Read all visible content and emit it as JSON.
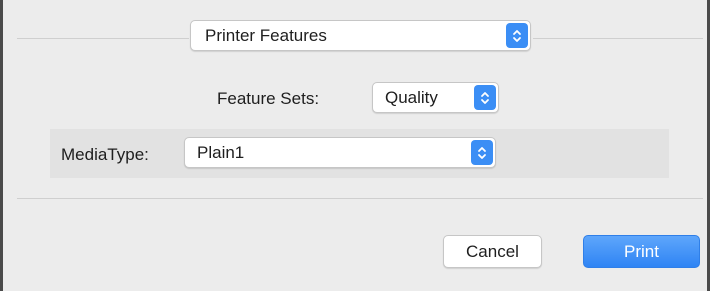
{
  "panel": {
    "title": "Printer Features"
  },
  "feature_sets": {
    "label": "Feature Sets:",
    "value": "Quality"
  },
  "media_type": {
    "label": "MediaType:",
    "value": "Plain1"
  },
  "buttons": {
    "cancel": "Cancel",
    "print": "Print"
  },
  "colors": {
    "accent": "#3b8ef5",
    "background": "#ececec",
    "group_box": "#e2e2e2"
  }
}
